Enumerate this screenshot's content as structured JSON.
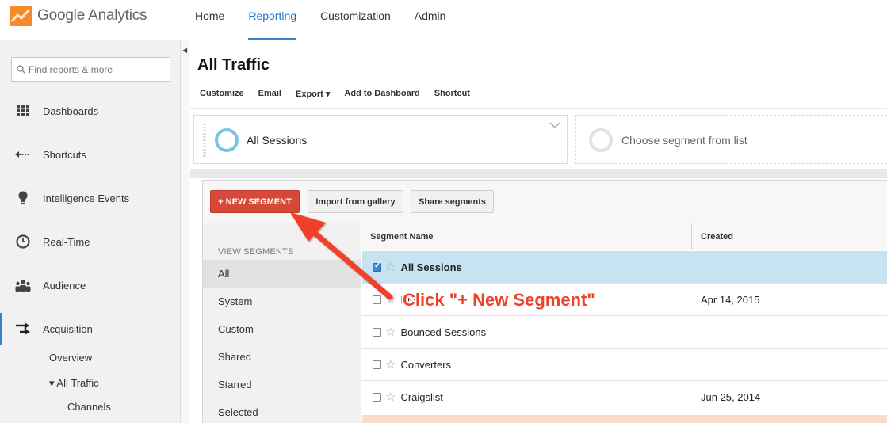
{
  "app": {
    "name": "Google Analytics"
  },
  "nav": {
    "items": [
      "Home",
      "Reporting",
      "Customization",
      "Admin"
    ],
    "active": "Reporting"
  },
  "sidebar": {
    "search_placeholder": "Find reports & more",
    "items": [
      {
        "label": "Dashboards",
        "icon": "grid-icon"
      },
      {
        "label": "Shortcuts",
        "icon": "shortcut-arrow-icon"
      },
      {
        "label": "Intelligence Events",
        "icon": "lightbulb-icon"
      },
      {
        "label": "Real-Time",
        "icon": "clock-icon"
      },
      {
        "label": "Audience",
        "icon": "people-icon"
      },
      {
        "label": "Acquisition",
        "icon": "acquisition-arrows-icon"
      }
    ],
    "sub_items": {
      "overview": "Overview",
      "all_traffic": "▾ All Traffic",
      "channels": "Channels"
    }
  },
  "page": {
    "title": "All Traffic",
    "toolbar": [
      "Customize",
      "Email",
      "Export ▾",
      "Add to Dashboard",
      "Shortcut"
    ]
  },
  "segments": {
    "active_segment": "All Sessions",
    "choose_placeholder": "Choose segment from list"
  },
  "segment_panel": {
    "new_button": "+ NEW SEGMENT",
    "import_button": "Import from gallery",
    "share_button": "Share segments",
    "view_heading": "VIEW SEGMENTS",
    "view_items": [
      "All",
      "System",
      "Custom",
      "Shared",
      "Starred",
      "Selected"
    ],
    "selected_view": "All",
    "columns": {
      "name": "Segment Name",
      "created": "Created"
    },
    "rows": [
      {
        "name": "All Sessions",
        "created": "",
        "checked": true
      },
      {
        "name": "Big Fruit",
        "created": "Apr 14, 2015",
        "checked": false
      },
      {
        "name": "Bounced Sessions",
        "created": "",
        "checked": false
      },
      {
        "name": "Converters",
        "created": "",
        "checked": false
      },
      {
        "name": "Craigslist",
        "created": "Jun 25, 2014",
        "checked": false
      }
    ]
  },
  "annotation": {
    "text": "Click \"+ New Segment\"",
    "color": "#f0402a"
  },
  "colors": {
    "accent": "#3b7fd1",
    "new_segment": "#d64837",
    "highlight_row": "#c7e3f1"
  }
}
